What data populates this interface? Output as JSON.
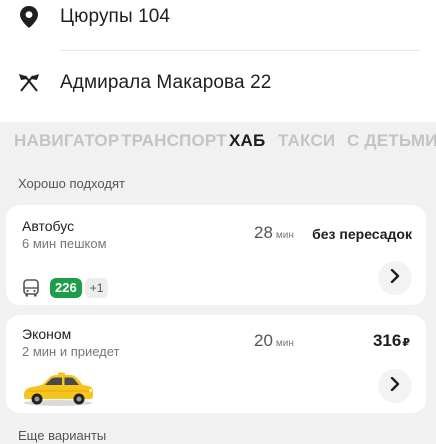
{
  "route": {
    "from": {
      "icon": "map-pin-icon",
      "address": "Цюрупы 104"
    },
    "to": {
      "icon": "crossed-flags-icon",
      "address": "Адмирала Макарова 22"
    }
  },
  "tabs": [
    {
      "label": "НАВИГАТОР",
      "active": false
    },
    {
      "label": "ТРАНСПОРТ",
      "active": false
    },
    {
      "label": "ХАБ",
      "active": true
    },
    {
      "label": "ТАКСИ",
      "active": false
    },
    {
      "label": "С ДЕТЬМИ",
      "active": false
    }
  ],
  "sections": {
    "recommended": "Хорошо подходят",
    "more": "Еще варианты"
  },
  "options": {
    "bus": {
      "title": "Автобус",
      "subtitle": "6 мин пешком",
      "time": "28",
      "time_unit": "мин",
      "extra": "без пересадок",
      "route_icon": "bus-icon",
      "route_number": "226",
      "more_routes": "+1"
    },
    "taxi": {
      "title": "Эконом",
      "subtitle": "2 мин и приедет",
      "time": "20",
      "time_unit": "мин",
      "price": "316",
      "currency": "₽",
      "image": "taxi-car-icon"
    }
  },
  "colors": {
    "route_badge": "#1e9e4a",
    "background": "#f1f1f1",
    "taxi_yellow": "#f6c51d"
  }
}
